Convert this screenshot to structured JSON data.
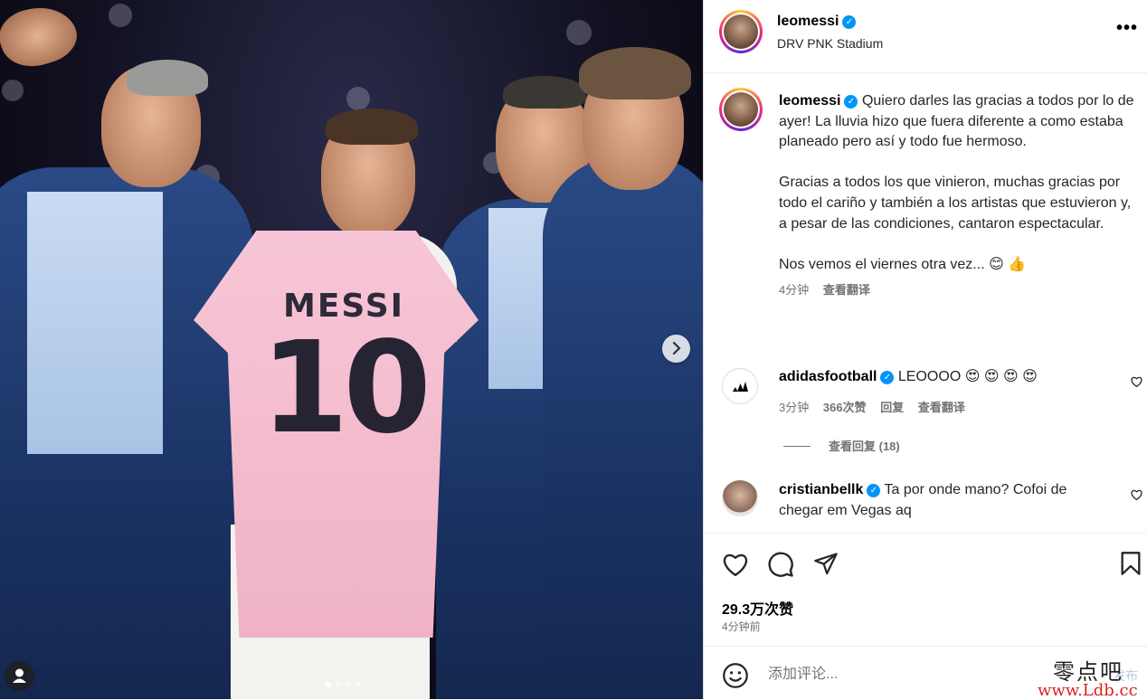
{
  "post": {
    "author": "leomessi",
    "location": "DRV PNK Stadium",
    "caption_paragraphs": [
      "Quiero darles las gracias a todos por lo de ayer! La lluvia hizo que fuera diferente a como estaba planeado pero así y todo fue hermoso.",
      "Gracias a todos los que vinieron, muchas gracias por todo el cariño y también a los artistas que estuvieron y, a pesar de las condiciones, cantaron espectacular.",
      "Nos vemos el viernes otra vez... 😊 👍"
    ],
    "caption_time": "4分钟",
    "translate_label": "查看翻译",
    "more_icon": "more-options-icon",
    "carousel": {
      "current": 1,
      "total": 4
    }
  },
  "media": {
    "jersey_name": "MESSI",
    "jersey_number": "10"
  },
  "comments": [
    {
      "username": "adidasfootball",
      "verified": true,
      "text": "LEOOOO 😍 😍 😍 😍",
      "time": "3分钟",
      "likes": "366次赞",
      "reply_label": "回复",
      "translate_label": "查看翻译",
      "view_replies": "查看回复 (18)"
    },
    {
      "username": "cristianbellk",
      "verified": true,
      "text": "Ta por onde mano? Cofoi de chegar em Vegas aq"
    }
  ],
  "stats": {
    "likes": "29.3万次赞",
    "posted": "4分钟前"
  },
  "add_comment": {
    "placeholder": "添加评论..."
  },
  "watermark": {
    "cn": "零点吧",
    "url": "www.Ldb.cc",
    "faded": "发布"
  },
  "colors": {
    "verified": "#0095f6",
    "secondary_text": "#737373",
    "watermark_url": "#e0201e"
  }
}
